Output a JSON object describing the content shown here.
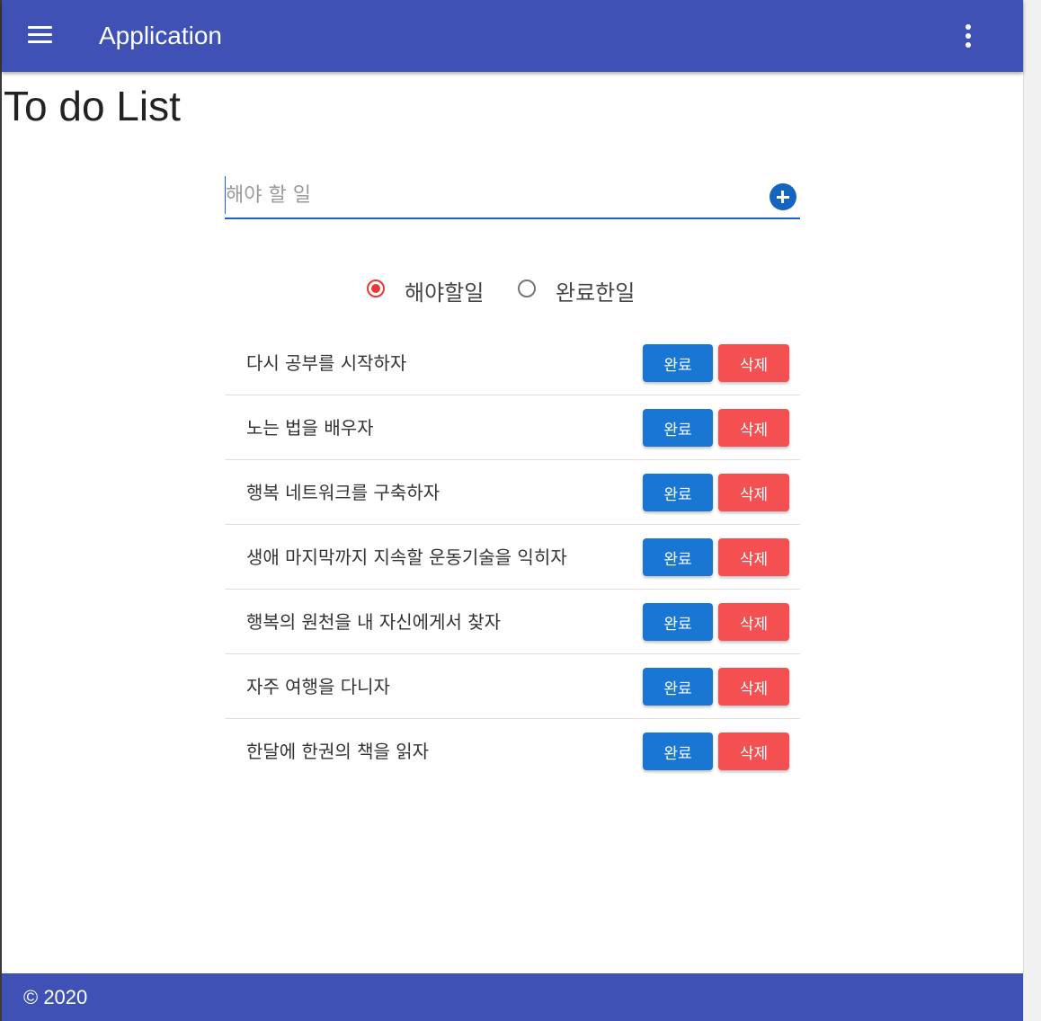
{
  "app_bar": {
    "title": "Application",
    "menu_icon": "hamburger-menu-icon",
    "more_icon": "more-vertical-icon",
    "color": "#3f51b5"
  },
  "page": {
    "heading": "To do List"
  },
  "todo_input": {
    "value": "",
    "placeholder": "해야 할 일",
    "add_icon": "add-circle-icon",
    "accent": "#1565c0"
  },
  "filter": {
    "options": [
      {
        "label": "해야할일",
        "selected": true
      },
      {
        "label": "완료한일",
        "selected": false
      }
    ],
    "selected_color": "#e53935"
  },
  "todos": [
    {
      "text": "다시 공부를 시작하자",
      "done_label": "완료",
      "delete_label": "삭제"
    },
    {
      "text": "노는 법을 배우자",
      "done_label": "완료",
      "delete_label": "삭제"
    },
    {
      "text": "행복 네트워크를 구축하자",
      "done_label": "완료",
      "delete_label": "삭제"
    },
    {
      "text": "생애 마지막까지 지속할 운동기술을 익히자",
      "done_label": "완료",
      "delete_label": "삭제"
    },
    {
      "text": "행복의 원천을 내 자신에게서 찾자",
      "done_label": "완료",
      "delete_label": "삭제"
    },
    {
      "text": "자주 여행을 다니자",
      "done_label": "완료",
      "delete_label": "삭제"
    },
    {
      "text": "한달에 한권의 책을 읽자",
      "done_label": "완료",
      "delete_label": "삭제"
    }
  ],
  "button_colors": {
    "done": "#1976d2",
    "delete": "#f45052"
  },
  "footer": {
    "text": "© 2020"
  }
}
